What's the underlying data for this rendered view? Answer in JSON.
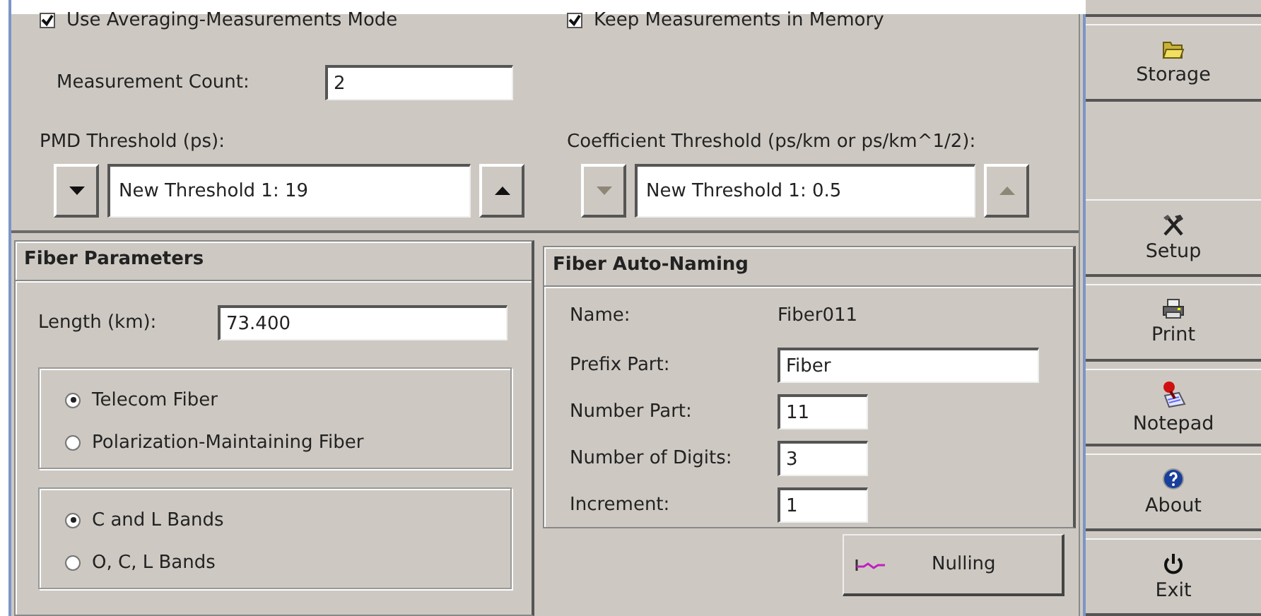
{
  "options": [
    {
      "label": "Use Averaging-Measurements Mode",
      "checked": true
    },
    {
      "label": "Keep Measurements in Memory",
      "checked": true
    }
  ],
  "measurement_count": {
    "label": "Measurement Count:",
    "value": "2"
  },
  "pmd_threshold": {
    "label": "PMD Threshold (ps):",
    "value": "New Threshold 1: 19",
    "disabled": false
  },
  "coefficient_threshold": {
    "label": "Coefficient Threshold (ps/km or ps/km^1/2):",
    "value": "New Threshold 1: 0.5",
    "disabled": true
  },
  "fiber_parameters": {
    "title": "Fiber Parameters",
    "length": {
      "label": "Length (km):",
      "value": "73.400"
    },
    "fiber_types": [
      {
        "label": "Telecom Fiber",
        "selected": true
      },
      {
        "label": "Polarization-Maintaining Fiber",
        "selected": false
      }
    ],
    "bands": [
      {
        "label": "C and L Bands",
        "selected": true
      },
      {
        "label": "O, C, L Bands",
        "selected": false
      }
    ]
  },
  "fiber_auto_naming": {
    "title": "Fiber Auto-Naming",
    "rows": [
      {
        "kind": "text",
        "label": "Name:",
        "value": "Fiber011"
      },
      {
        "kind": "long-field",
        "label": "Prefix Part:",
        "value": "Fiber"
      },
      {
        "kind": "short-field",
        "label": "Number Part:",
        "value": "11"
      },
      {
        "kind": "short-field",
        "label": "Number of Digits:",
        "value": "3"
      },
      {
        "kind": "short-field",
        "label": "Increment:",
        "value": "1"
      }
    ]
  },
  "nulling_button": {
    "label": "Nulling"
  },
  "sidebar": [
    {
      "label": "Storage"
    },
    {
      "label": "Setup"
    },
    {
      "label": "Print"
    },
    {
      "label": "Notepad"
    },
    {
      "label": "About"
    },
    {
      "label": "Exit"
    }
  ]
}
